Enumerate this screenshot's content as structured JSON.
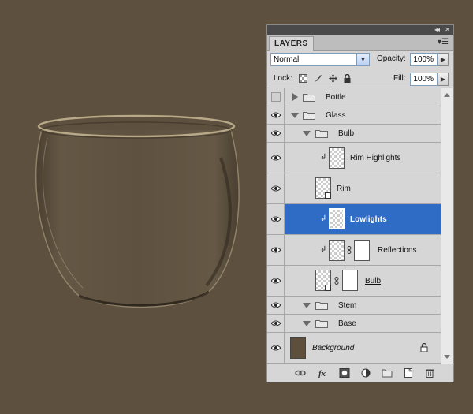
{
  "panel": {
    "tab_label": "LAYERS",
    "collapse_glyph": "◂◂",
    "close_glyph": "✕",
    "menu_glyph": "▾☰"
  },
  "blend": {
    "mode": "Normal",
    "opacity_label": "Opacity:",
    "opacity_value": "100%",
    "fill_label": "Fill:",
    "fill_value": "100%"
  },
  "lock": {
    "label": "Lock:"
  },
  "layers": [
    {
      "name": "Bottle",
      "type": "group",
      "visible": false,
      "expanded": false,
      "depth": 0
    },
    {
      "name": "Glass",
      "type": "group",
      "visible": true,
      "expanded": true,
      "depth": 0
    },
    {
      "name": "Bulb",
      "type": "group",
      "visible": true,
      "expanded": true,
      "depth": 1
    },
    {
      "name": "Rim Highlights",
      "type": "layer",
      "visible": true,
      "clipped": true
    },
    {
      "name": "Rim",
      "type": "smart-object",
      "visible": true,
      "underlined": true
    },
    {
      "name": "Lowlights",
      "type": "layer",
      "visible": true,
      "clipped": true,
      "selected": true
    },
    {
      "name": "Reflections",
      "type": "layer-with-mask",
      "visible": true,
      "clipped": true
    },
    {
      "name": "Bulb",
      "type": "smart-object-with-mask",
      "visible": true,
      "underlined": true
    },
    {
      "name": "Stem",
      "type": "group",
      "visible": true,
      "expanded": false,
      "depth": 1
    },
    {
      "name": "Base",
      "type": "group",
      "visible": true,
      "expanded": false,
      "depth": 1
    },
    {
      "name": "Background",
      "type": "background",
      "visible": true,
      "locked": true,
      "italic": true
    }
  ],
  "colors": {
    "canvas": "#5d503f",
    "selected_row": "#2f6cc6",
    "background_swatch": "#5e4f3c"
  },
  "footer_icons": [
    "link-icon",
    "fx-icon",
    "add-mask-icon",
    "adjustment-layer-icon",
    "new-group-icon",
    "new-layer-icon",
    "trash-icon"
  ]
}
